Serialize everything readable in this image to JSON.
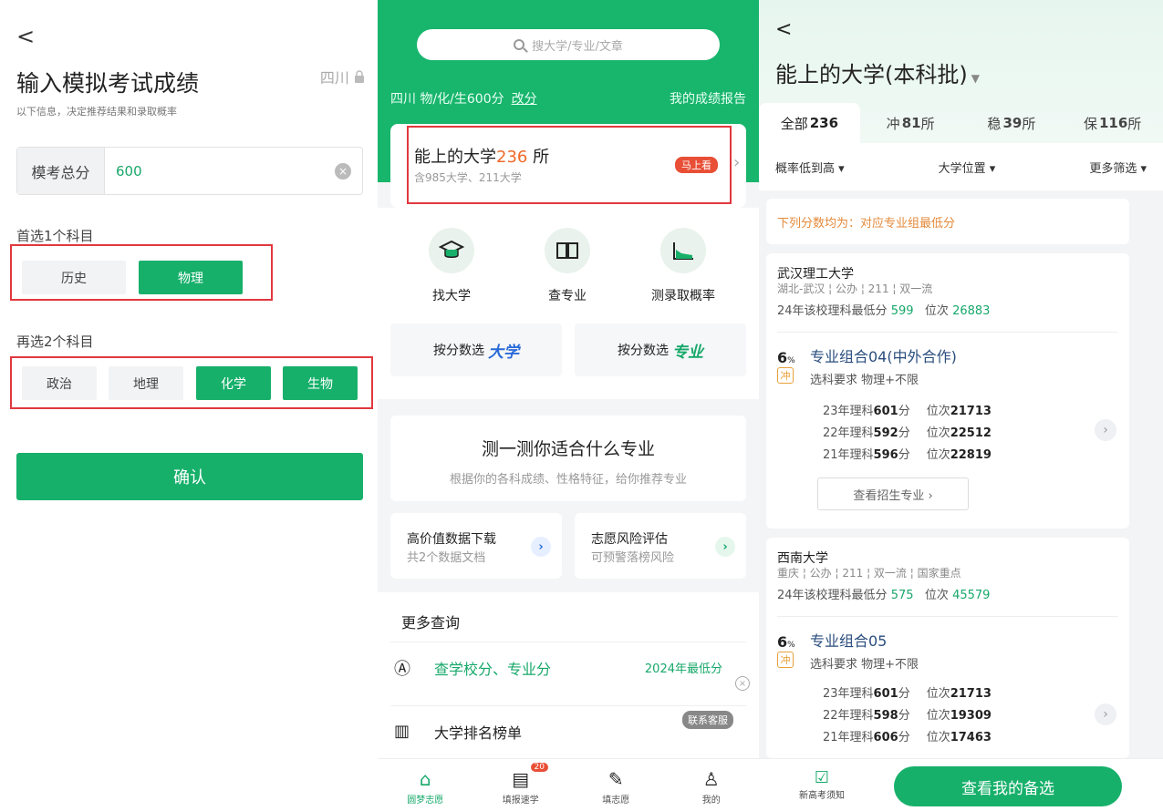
{
  "colors": {
    "brand_green": "#17b06b",
    "highlight_red": "#e0383e",
    "accent_orange": "#ee6a2a"
  },
  "p1": {
    "back": "<",
    "title": "输入模拟考试成绩",
    "region": "四川",
    "lock_icon": "lock-icon",
    "subtitle": "以下信息，决定推荐结果和录取概率",
    "score_label": "模考总分",
    "score_value": "600",
    "first_label": "首选1个科目",
    "first_options": [
      {
        "label": "历史",
        "selected": false
      },
      {
        "label": "物理",
        "selected": true
      }
    ],
    "second_label": "再选2个科目",
    "second_options": [
      {
        "label": "政治",
        "selected": false
      },
      {
        "label": "地理",
        "selected": false
      },
      {
        "label": "化学",
        "selected": true
      },
      {
        "label": "生物",
        "selected": true
      }
    ],
    "confirm": "确认"
  },
  "p2": {
    "search_placeholder": "搜大学/专业/文章",
    "info": "四川 物/化/生600分",
    "change": "改分",
    "report": "我的成绩报告",
    "card_title": "能上的大学",
    "card_count": "236",
    "card_unit": "所",
    "card_sub": "含985大学、211大学",
    "card_badge": "马上看",
    "tools": [
      "找大学",
      "查专业",
      "测录取概率"
    ],
    "score_find_1": "按分数选",
    "score_find_1b": "大学",
    "score_find_2": "按分数选",
    "score_find_2b": "专业",
    "test_title": "测一测你适合什么专业",
    "test_sub": "根据你的各科成绩、性格特征，给你推荐专业",
    "mini1_title": "高价值数据下载",
    "mini1_sub": "共2个数据文档",
    "mini2_title": "志愿风险评估",
    "mini2_sub": "可预警落榜风险",
    "more_header": "更多查询",
    "row1_label": "查学校分、专业分",
    "row1_right": "2024年最低分",
    "row2_label": "大学排名榜单",
    "service": "联系客服",
    "nav": [
      {
        "label": "圆梦志愿",
        "active": true
      },
      {
        "label": "填报速学",
        "active": false,
        "badge": "20"
      },
      {
        "label": "填志愿",
        "active": false
      },
      {
        "label": "我的",
        "active": false
      }
    ]
  },
  "p3": {
    "back": "<",
    "title": "能上的大学(本科批)",
    "tabs": [
      {
        "label": "全部",
        "count": "236",
        "unit": ""
      },
      {
        "label": "冲",
        "count": "81",
        "unit": "所"
      },
      {
        "label": "稳",
        "count": "39",
        "unit": "所"
      },
      {
        "label": "保",
        "count": "116",
        "unit": "所"
      }
    ],
    "filters": [
      "概率低到高 ▾",
      "大学位置 ▾",
      "更多筛选 ▾"
    ],
    "note": "下列分数均为：对应专业组最低分",
    "cards": [
      {
        "name": "武汉理工大学",
        "tags": "湖北-武汉 ¦ 公办 ¦ 211 ¦ 双一流",
        "line_prefix": "24年该校理科最低分",
        "min_score": "599",
        "rank_prefix": "位次",
        "min_rank": "26883",
        "pct": "6",
        "pct_unit": "%",
        "chong": "冲",
        "group": "专业组合04(中外合作)",
        "req": "选科要求 物理+不限",
        "years": [
          {
            "y": "23年理科",
            "s": "601",
            "u": "分",
            "rl": "位次",
            "r": "21713"
          },
          {
            "y": "22年理科",
            "s": "592",
            "u": "分",
            "rl": "位次",
            "r": "22512"
          },
          {
            "y": "21年理科",
            "s": "596",
            "u": "分",
            "rl": "位次",
            "r": "22819"
          }
        ],
        "view": "查看招生专业 ›"
      },
      {
        "name": "西南大学",
        "tags": "重庆 ¦ 公办 ¦ 211 ¦ 双一流 ¦ 国家重点",
        "line_prefix": "24年该校理科最低分",
        "min_score": "575",
        "rank_prefix": "位次",
        "min_rank": "45579",
        "pct": "6",
        "pct_unit": "%",
        "chong": "冲",
        "group": "专业组合05",
        "req": "选科要求 物理+不限",
        "years": [
          {
            "y": "23年理科",
            "s": "601",
            "u": "分",
            "rl": "位次",
            "r": "21713"
          },
          {
            "y": "22年理科",
            "s": "598",
            "u": "分",
            "rl": "位次",
            "r": "19309"
          },
          {
            "y": "21年理科",
            "s": "606",
            "u": "分",
            "rl": "位次",
            "r": "17463"
          }
        ]
      }
    ],
    "bottom_left": "新高考须知",
    "bottom_btn": "查看我的备选"
  }
}
